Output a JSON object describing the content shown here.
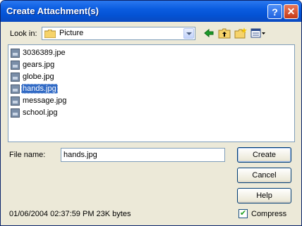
{
  "window": {
    "title": "Create Attachment(s)"
  },
  "lookin": {
    "label": "Look in:",
    "value": "Picture"
  },
  "files": [
    {
      "name": "3036389.jpe",
      "selected": false
    },
    {
      "name": "gears.jpg",
      "selected": false
    },
    {
      "name": "globe.jpg",
      "selected": false
    },
    {
      "name": "hands.jpg",
      "selected": true
    },
    {
      "name": "message.jpg",
      "selected": false
    },
    {
      "name": "school.jpg",
      "selected": false
    }
  ],
  "filename": {
    "label": "File name:",
    "value": "hands.jpg"
  },
  "buttons": {
    "create": "Create",
    "cancel": "Cancel",
    "help": "Help"
  },
  "status": "01/06/2004 02:37:59 PM 23K bytes",
  "compress": {
    "label": "Compress",
    "checked": true
  },
  "titlebuttons": {
    "help": "?",
    "close": "✕"
  }
}
